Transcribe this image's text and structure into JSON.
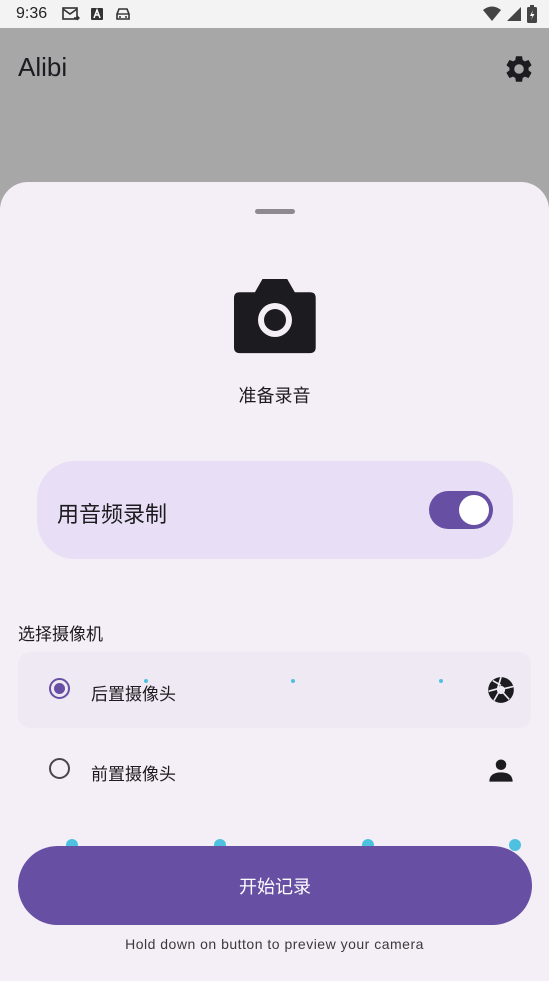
{
  "status_bar": {
    "time": "9:36"
  },
  "app_bar": {
    "title": "Alibi"
  },
  "sheet": {
    "status_label": "准备录音",
    "audio_toggle": {
      "label": "用音频录制",
      "enabled": true
    },
    "camera_section_title": "选择摄像机",
    "camera_options": [
      {
        "label": "后置摄像头",
        "selected": true,
        "icon": "camera-shutter-icon"
      },
      {
        "label": "前置摄像头",
        "selected": false,
        "icon": "person-icon"
      }
    ],
    "record_button_label": "开始记录",
    "hint_text": "Hold down on button to preview your camera"
  },
  "colors": {
    "accent": "#6750a4",
    "card_background": "#e8def5",
    "sheet_background": "#f4eff6",
    "scrim": "#a8a7a8"
  }
}
